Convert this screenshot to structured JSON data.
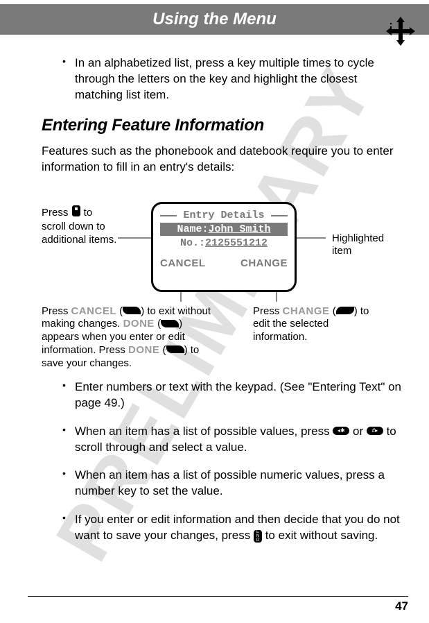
{
  "header": {
    "title": "Using the Menu"
  },
  "watermark": "PRELIMINARY",
  "bullets_top": [
    "In an alphabetized list, press a key multiple times to cycle through the letters on the key and highlight the closest matching list item."
  ],
  "section_heading": "Entering Feature Information",
  "intro": "Features such as the phonebook and datebook require you to enter information to fill in an entry's details:",
  "screen": {
    "title": "Entry Details",
    "name_label": "Name:",
    "name_value": "John Smith",
    "no_label": "No.:",
    "no_value": "2125551212",
    "softkey_left": "CANCEL",
    "softkey_right": "CHANGE"
  },
  "callouts": {
    "left_top_a": "Press ",
    "left_top_b": " to scroll down to additional items.",
    "right_top": "Highlighted item",
    "left_bottom_a": "Press ",
    "left_bottom_cancel": "CANCEL",
    "left_bottom_b": " (",
    "left_bottom_c": ") to exit without making changes. ",
    "left_bottom_done1": "DONE",
    "left_bottom_d": " (",
    "left_bottom_e": ") appears when you enter or edit information. Press ",
    "left_bottom_done2": "DONE",
    "left_bottom_f": " (",
    "left_bottom_g": ") to save your changes.",
    "right_bottom_a": "Press ",
    "right_bottom_change": "CHANGE",
    "right_bottom_b": " (",
    "right_bottom_c": ") to edit the selected information."
  },
  "bullets_bottom": [
    {
      "pre": "Enter numbers or text with the keypad. (See \"Entering Text\" on page 49.)"
    },
    {
      "a": "When an item has a list of possible values, press ",
      "b": " or ",
      "c": " to scroll through and select a value."
    },
    {
      "pre": "When an item has a list of possible numeric values, press a number key to set the value."
    },
    {
      "a": "If you enter or edit information and then decide that you do not want to save your changes, press ",
      "c": " to exit without saving."
    }
  ],
  "page_number": "47"
}
